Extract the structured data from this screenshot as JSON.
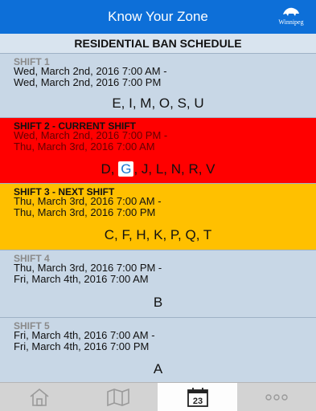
{
  "header": {
    "title": "Know Your Zone",
    "logo_text": "Winnipeg"
  },
  "subtitle": "RESIDENTIAL BAN SCHEDULE",
  "shifts": [
    {
      "label": "SHIFT 1",
      "start": "Wed, March 2nd, 2016 7:00 AM -",
      "end": "Wed, March 2nd, 2016 7:00 PM",
      "zones": "E, I, M, O, S, U"
    },
    {
      "label": "SHIFT 2 - CURRENT SHIFT",
      "start": "Wed, March 2nd, 2016 7:00 PM -",
      "end": "Thu, March 3rd, 2016 7:00 AM",
      "zones_before": "D,",
      "zones_highlight": "G",
      "zones_after": ", J, L, N, R, V"
    },
    {
      "label": "SHIFT 3 - NEXT SHIFT",
      "start": "Thu, March 3rd, 2016 7:00 AM -",
      "end": "Thu, March 3rd, 2016 7:00 PM",
      "zones": "C, F, H, K, P, Q, T"
    },
    {
      "label": "SHIFT 4",
      "start": "Thu, March 3rd, 2016 7:00 PM -",
      "end": "Fri, March 4th, 2016 7:00 AM",
      "zones": "B"
    },
    {
      "label": "SHIFT 5",
      "start": "Fri, March 4th, 2016 7:00 AM -",
      "end": "Fri, March 4th, 2016 7:00 PM",
      "zones": "A"
    }
  ],
  "tabs": [
    {
      "icon": "home-icon"
    },
    {
      "icon": "map-icon"
    },
    {
      "icon": "calendar-icon",
      "text": "23",
      "active": true
    },
    {
      "icon": "more-icon"
    }
  ],
  "colors": {
    "header": "#0d6fd8",
    "current": "#ff0000",
    "next": "#ffc000",
    "default": "#c8d7e6"
  }
}
